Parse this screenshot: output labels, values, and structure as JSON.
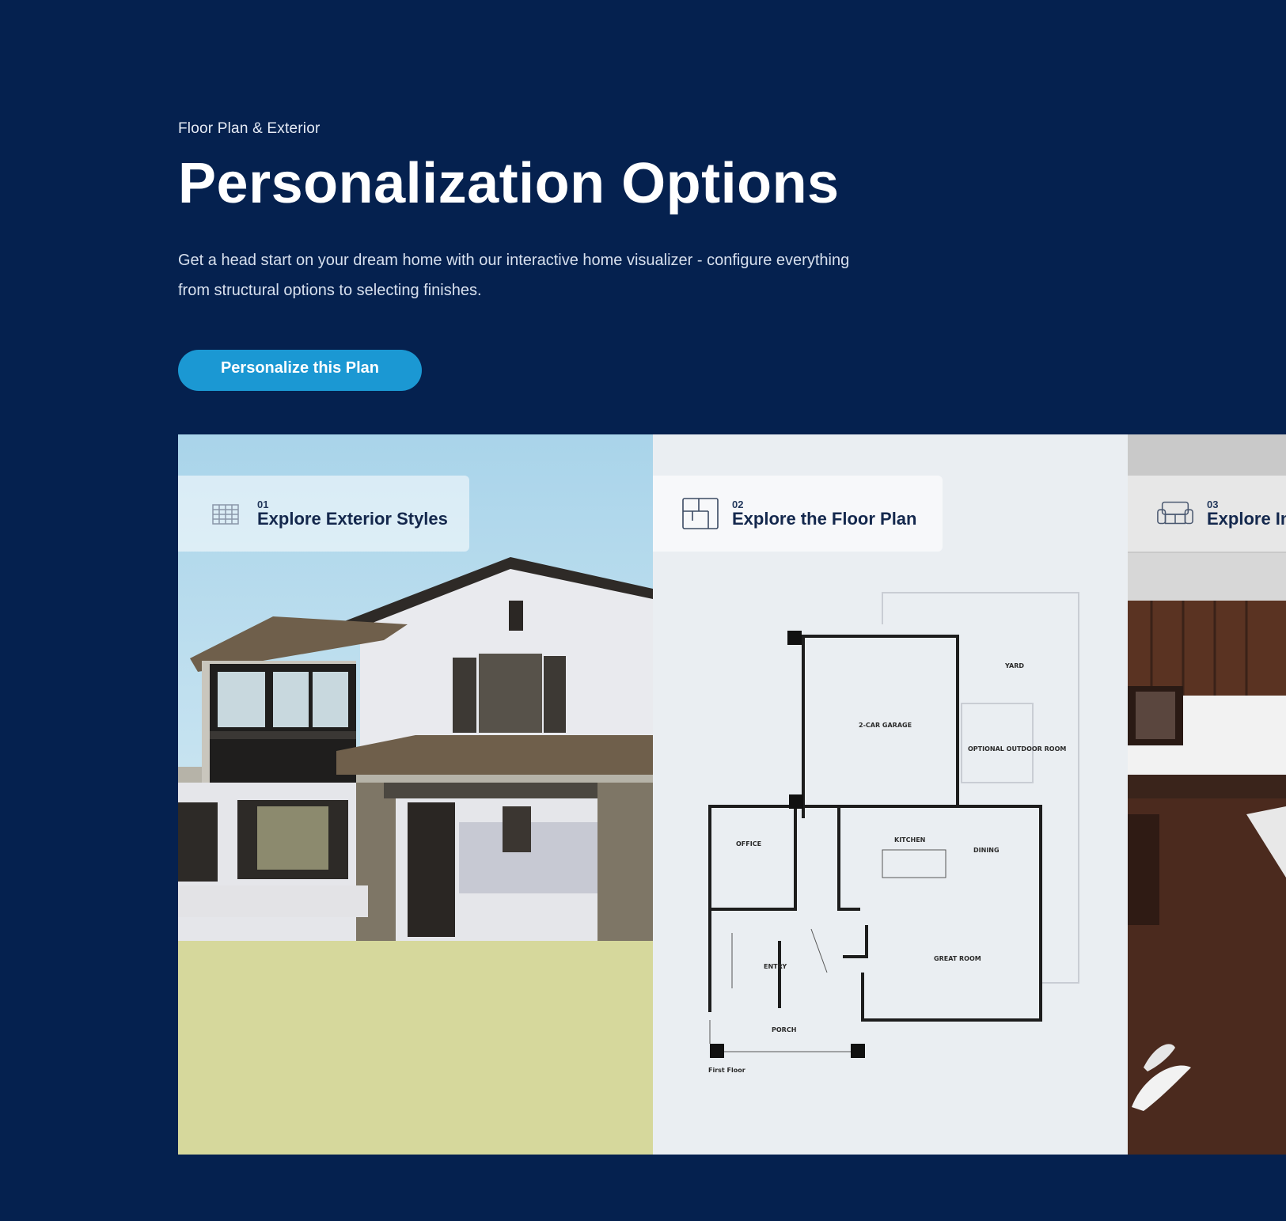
{
  "eyebrow": "Floor Plan & Exterior",
  "title": "Personalization Options",
  "description": "Get a head start on your dream home with our interactive home visualizer - configure everything from structural options to selecting finishes.",
  "cta_label": "Personalize this Plan",
  "panels": [
    {
      "number": "01",
      "label": "Explore Exterior Styles",
      "icon": "house-facade-icon"
    },
    {
      "number": "02",
      "label": "Explore the Floor Plan",
      "icon": "floor-plan-icon"
    },
    {
      "number": "03",
      "label": "Explore In",
      "icon": "sofa-icon"
    }
  ],
  "floor_plan_labels": {
    "yard": "YARD",
    "garage": "2-CAR GARAGE",
    "optional_room": "OPTIONAL OUTDOOR ROOM",
    "office": "OFFICE",
    "kitchen": "KITCHEN",
    "dining": "DINING",
    "entry": "ENTRY",
    "great_room": "GREAT ROOM",
    "porch": "PORCH",
    "first_floor": "First Floor"
  },
  "colors": {
    "background": "#05214f",
    "cta": "#1b98d3"
  }
}
